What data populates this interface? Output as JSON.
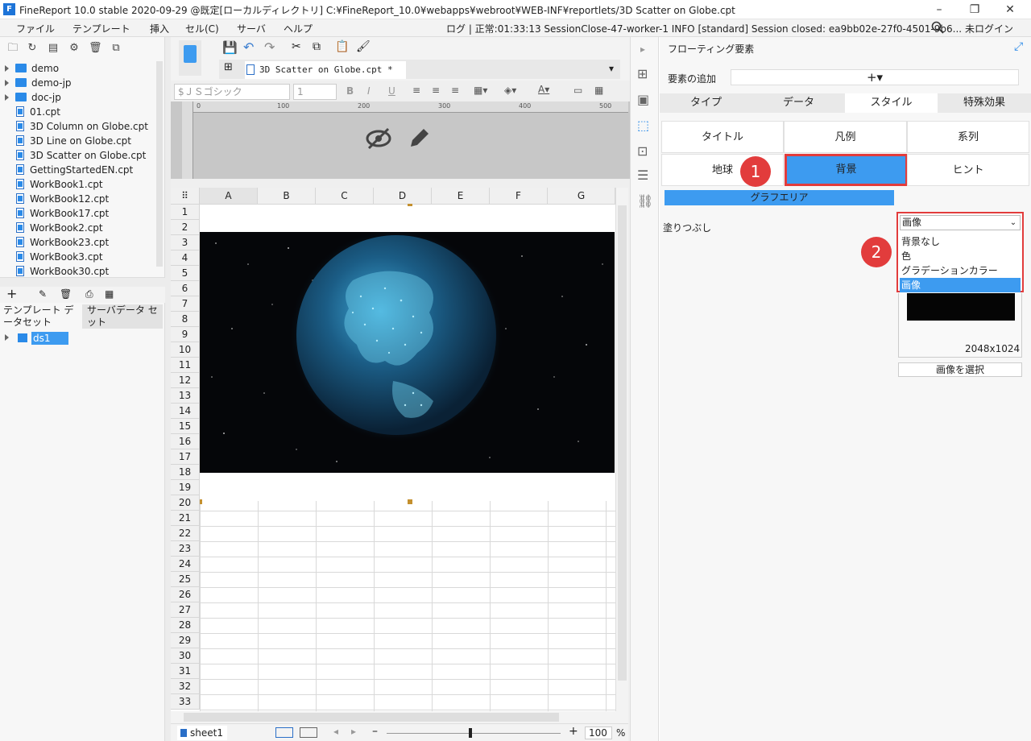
{
  "window": {
    "title": "FineReport 10.0 stable 2020-09-29 @既定[ローカルディレクトリ]    C:¥FineReport_10.0¥webapps¥webroot¥WEB-INF¥reportlets/3D Scatter on Globe.cpt",
    "logo_letter": "F",
    "minimize": "–",
    "restore": "❐",
    "close": "✕"
  },
  "menubar": {
    "items": [
      "ファイル",
      "テンプレート",
      "挿入",
      "セル(C)",
      "サーバ",
      "ヘルプ"
    ],
    "status": "ログ | 正常:01:33:13 SessionClose-47-worker-1 INFO [standard] Session closed: ea9bb02e-27f0-4501-9b6...",
    "login": "未ログイン"
  },
  "tree": {
    "items": [
      {
        "label": "demo",
        "type": "folder"
      },
      {
        "label": "demo-jp",
        "type": "folder"
      },
      {
        "label": "doc-jp",
        "type": "folder"
      },
      {
        "label": "01.cpt",
        "type": "file"
      },
      {
        "label": "3D Column on Globe.cpt",
        "type": "file"
      },
      {
        "label": "3D Line on Globe.cpt",
        "type": "file"
      },
      {
        "label": "3D Scatter on Globe.cpt",
        "type": "file"
      },
      {
        "label": "GettingStartedEN.cpt",
        "type": "file"
      },
      {
        "label": "WorkBook1.cpt",
        "type": "file"
      },
      {
        "label": "WorkBook12.cpt",
        "type": "file"
      },
      {
        "label": "WorkBook17.cpt",
        "type": "file"
      },
      {
        "label": "WorkBook2.cpt",
        "type": "file"
      },
      {
        "label": "WorkBook23.cpt",
        "type": "file"
      },
      {
        "label": "WorkBook3.cpt",
        "type": "file"
      },
      {
        "label": "WorkBook30.cpt",
        "type": "file"
      }
    ]
  },
  "dataset_panel": {
    "tab_template": "テンプレート データセット",
    "tab_server": "サーバデータ セット",
    "ds_item": "ds1"
  },
  "editor": {
    "tab_label": "3D Scatter on Globe.cpt *",
    "font_name": "$ＪＳゴシック",
    "font_size": "1",
    "ruler_marks": [
      "0",
      "100",
      "200",
      "300",
      "400",
      "500"
    ],
    "columns": [
      "A",
      "B",
      "C",
      "D",
      "E",
      "F",
      "G"
    ],
    "rows": [
      "1",
      "2",
      "3",
      "4",
      "5",
      "6",
      "7",
      "8",
      "9",
      "10",
      "11",
      "12",
      "13",
      "14",
      "15",
      "16",
      "17",
      "18",
      "19",
      "20",
      "21",
      "22",
      "23",
      "24",
      "25",
      "26",
      "27",
      "28",
      "29",
      "30",
      "31",
      "32",
      "33"
    ],
    "sheet": "sheet1",
    "zoom": "100",
    "zoom_unit": "%"
  },
  "right_panel": {
    "title": "フローティング要素",
    "add_label": "要素の追加",
    "add_button": "+▾",
    "tabs": [
      "タイプ",
      "データ",
      "スタイル",
      "特殊効果"
    ],
    "active_tab": "スタイル",
    "subbuttons": [
      "タイトル",
      "凡例",
      "系列",
      "地球",
      "背景",
      "ヒント"
    ],
    "active_sub": "背景",
    "graph_area": "グラフエリア",
    "fill_label": "塗りつぶし",
    "fill_value": "画像",
    "fill_options": [
      "背景なし",
      "色",
      "グラデーションカラー",
      "画像"
    ],
    "image_size": "2048x1024",
    "select_image": "画像を選択",
    "badge1": "1",
    "badge2": "2"
  },
  "colors": {
    "accent": "#3d9bf0",
    "highlight_border": "#e23c3c",
    "badge": "#e23c3c"
  }
}
